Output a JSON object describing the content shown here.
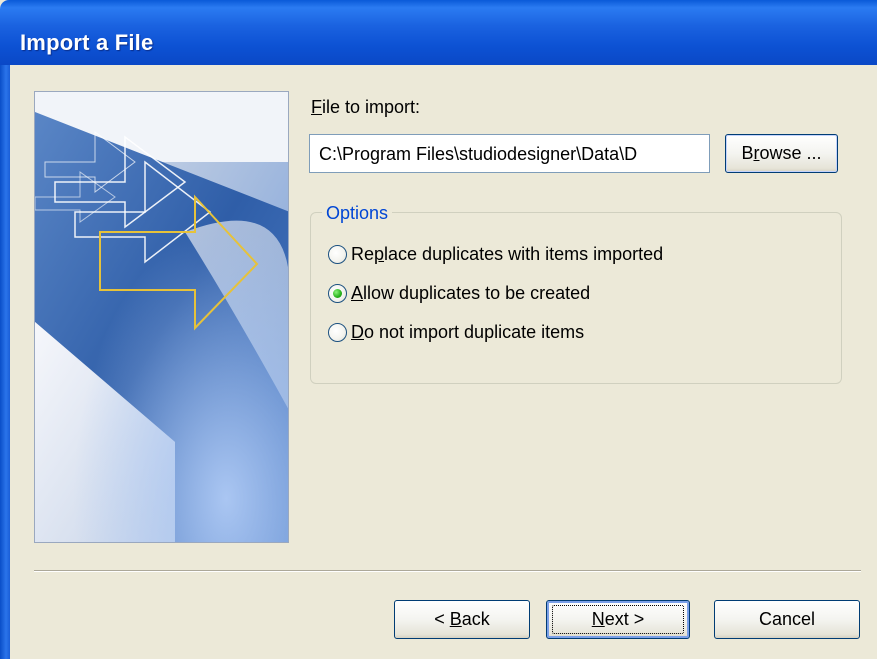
{
  "window": {
    "title": "Import a File"
  },
  "main": {
    "file_label_prefix": "F",
    "file_label_rest": "ile to import:",
    "file_path": "C:\\Program Files\\studiodesigner\\Data\\D",
    "browse": {
      "prefix": "B",
      "ul": "r",
      "rest": "owse ..."
    }
  },
  "options": {
    "legend": "Options",
    "items": [
      {
        "prefix": "Re",
        "ul": "p",
        "rest": "lace duplicates with items imported",
        "checked": false
      },
      {
        "prefix": "",
        "ul": "A",
        "rest": "llow duplicates to be created",
        "checked": true
      },
      {
        "prefix": "",
        "ul": "D",
        "rest": "o not import duplicate items",
        "checked": false
      }
    ]
  },
  "footer": {
    "back": {
      "prefix": "< ",
      "ul": "B",
      "rest": "ack"
    },
    "next": {
      "prefix": "",
      "ul": "N",
      "rest": "ext >"
    },
    "cancel": "Cancel"
  },
  "colors": {
    "title_bar": "#0a5ad8",
    "dialog_bg": "#ece9d8",
    "group_legend": "#0046d5",
    "radio_selected": "#27b11b"
  },
  "icons": {
    "wizard_art": "import-arrows-icon"
  }
}
